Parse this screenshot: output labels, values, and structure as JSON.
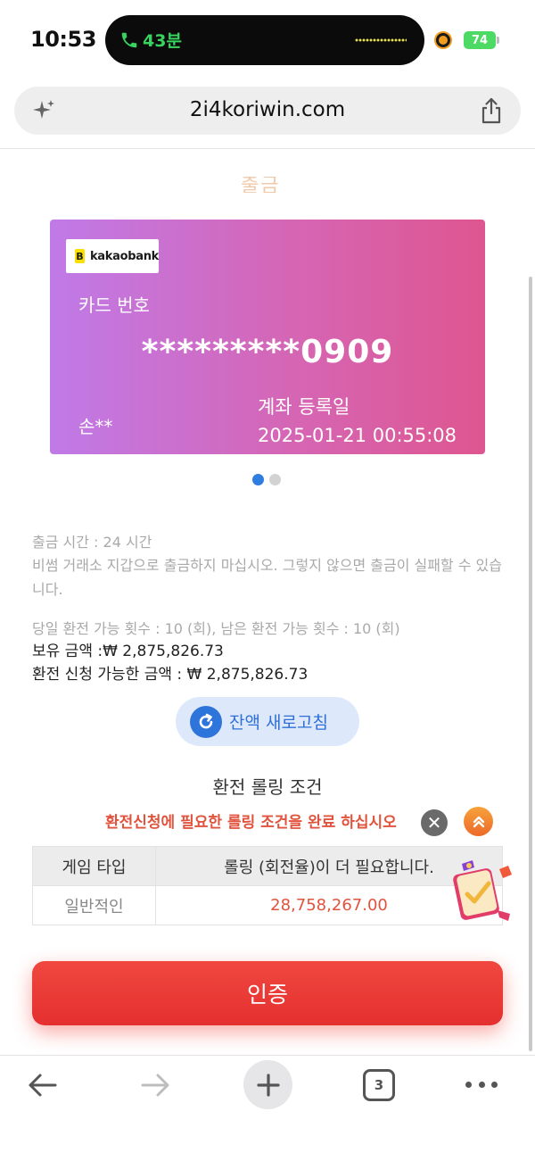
{
  "status_bar": {
    "time": "10:53",
    "call_duration": "43분",
    "battery": "74",
    "icons": [
      "phone-icon",
      "recording-dot-icon",
      "battery-charging-icon"
    ]
  },
  "browser": {
    "url": "2i4koriwin.com",
    "icons": [
      "sparkle-icon",
      "share-icon"
    ],
    "nav": {
      "tab_count": "3",
      "icons": [
        "back-arrow-icon",
        "forward-arrow-icon",
        "plus-icon",
        "tabs-icon",
        "more-icon"
      ]
    }
  },
  "page": {
    "cut_off_header": "출금",
    "card": {
      "bank_logo": "kakaobank",
      "bank_logo_mark": "B",
      "card_number_label": "카드 번호",
      "card_number": "*********0909",
      "holder": "손**",
      "registered_label": "계좌 등록일",
      "registered_date": "2025-01-21 00:55:08"
    },
    "carousel": {
      "count": 2,
      "active_index": 0
    },
    "info": {
      "withdraw_time": "출금 시간 :  24 시간",
      "warning": "비썸 거래소 지갑으로 출금하지 마십시오. 그렇지 않으면 출금이 실패할 수 있습니다.",
      "exchange_count": "당일 환전 가능 횟수 : 10 (회), 남은 환전 가능 횟수 : 10 (회)",
      "balance": "보유 금액 :₩ 2,875,826.73",
      "available": "환전 신청 가능한 금액 : ₩ 2,875,826.73"
    },
    "refresh_button": "잔액 새로고침",
    "rolling": {
      "title": "환전 롤링 조건",
      "notice": "환전신청에 필요한 롤링 조건을 완료 하십시오",
      "headers": [
        "게임 타입",
        "롤링 (회전율)이 더 필요합니다."
      ],
      "rows": [
        [
          "일반적인",
          "28,758,267.00"
        ]
      ]
    },
    "close_glyph": "✕",
    "verify_button": "인증"
  },
  "colors": {
    "card_gradient": [
      "#c07ae8",
      "#de5690"
    ],
    "accent_blue": "#2f7de1",
    "accent_red": "#e4302f",
    "warn_text": "#e0533d"
  }
}
